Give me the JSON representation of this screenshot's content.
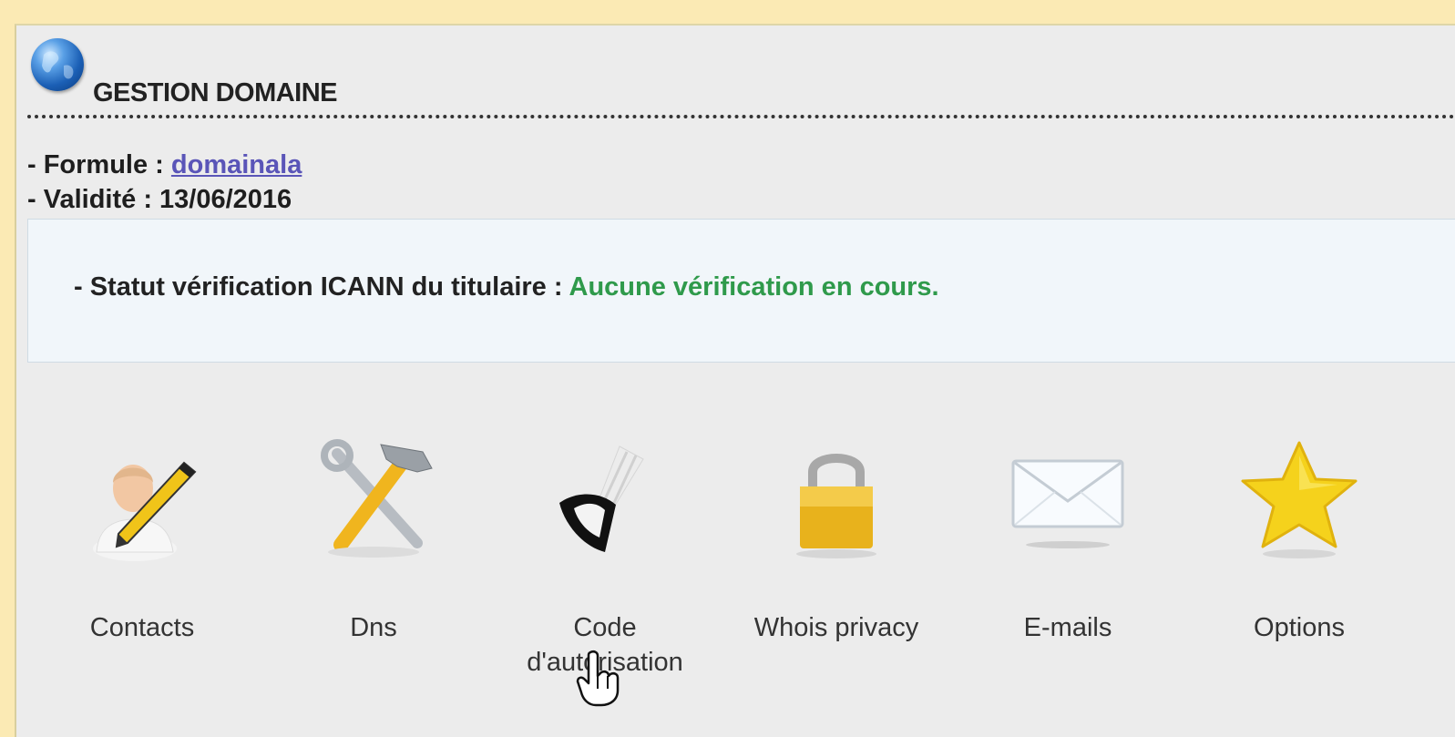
{
  "header": {
    "title": "GESTION DOMAINE",
    "icon": "globe-icon"
  },
  "info": {
    "formule_label": "- Formule :",
    "formule_value": "domainala",
    "validite_label": "- Validité :",
    "validite_value": "13/06/2016"
  },
  "status": {
    "label": "- Statut vérification ICANN du titulaire :",
    "value": "Aucune vérification en cours.",
    "value_color": "#2f9a4b"
  },
  "tiles": [
    {
      "label": "Contacts",
      "icon": "contact-edit-icon"
    },
    {
      "label": "Dns",
      "icon": "tools-icon"
    },
    {
      "label_line1": "Code",
      "label_line2": "d'autorisation",
      "icon": "key-icon"
    },
    {
      "label": "Whois privacy",
      "icon": "lock-icon"
    },
    {
      "label": "E-mails",
      "icon": "envelope-icon"
    },
    {
      "label": "Options",
      "icon": "star-icon"
    }
  ],
  "colors": {
    "background": "#fbeab4",
    "panel": "#ececec",
    "link": "#5a55b8"
  }
}
